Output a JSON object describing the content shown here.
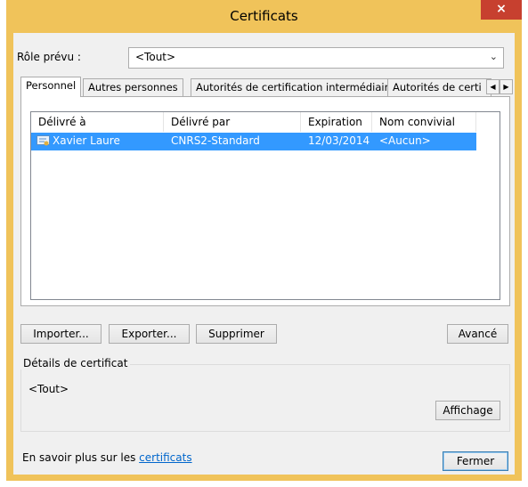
{
  "window": {
    "title": "Certificats",
    "close_label": "×"
  },
  "role": {
    "label": "Rôle prévu :",
    "value": "<Tout>"
  },
  "tabs": [
    {
      "label": "Personnel",
      "active": true
    },
    {
      "label": "Autres personnes",
      "active": false
    },
    {
      "label": "Autorités de certification intermédiaires",
      "active": false
    },
    {
      "label": "Autorités de certi",
      "active": false
    }
  ],
  "table": {
    "columns": [
      "Délivré à",
      "Délivré par",
      "Expiration",
      "Nom convivial"
    ],
    "rows": [
      {
        "issued_to": "Xavier Laure",
        "issued_by": "CNRS2-Standard",
        "expiration": "12/03/2014",
        "friendly_name": "<Aucun>",
        "selected": true
      }
    ]
  },
  "buttons": {
    "import": "Importer...",
    "export": "Exporter...",
    "remove": "Supprimer",
    "advanced": "Avancé",
    "view": "Affichage",
    "close": "Fermer"
  },
  "details": {
    "title": "Détails de certificat",
    "value": "<Tout>"
  },
  "footer": {
    "text": "En savoir plus sur les ",
    "link": "certificats"
  },
  "colors": {
    "frame": "#f0c35a",
    "selection": "#3399ff",
    "close": "#c7402f"
  }
}
